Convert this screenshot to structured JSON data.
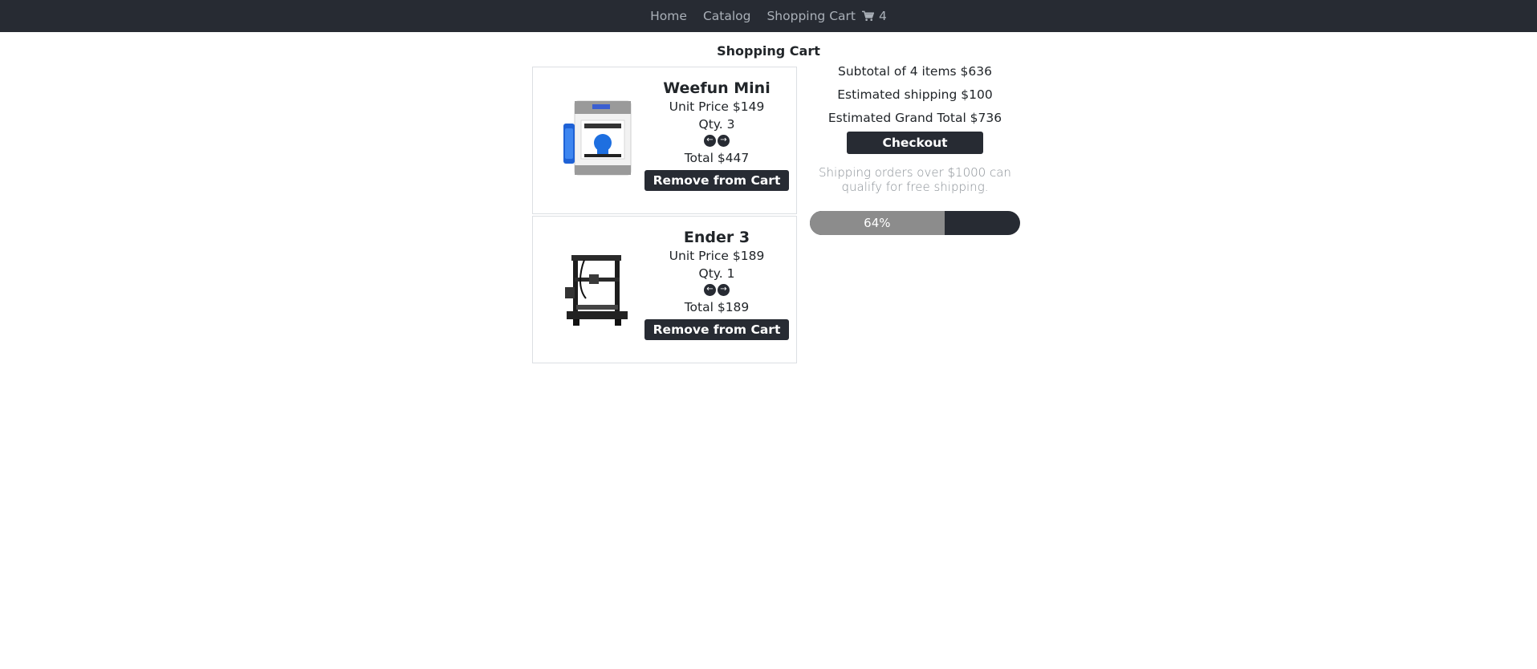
{
  "nav": {
    "home_label": "Home",
    "catalog_label": "Catalog",
    "cart_label": "Shopping Cart",
    "cart_count": "4",
    "cart_icon": "shopping-cart-icon"
  },
  "page": {
    "title": "Shopping Cart"
  },
  "items": [
    {
      "name": "Weefun Mini",
      "unit_price": "Unit Price $149",
      "qty": "Qty. 3",
      "total": "Total $447",
      "remove_label": "Remove from Cart"
    },
    {
      "name": "Ender 3",
      "unit_price": "Unit Price $189",
      "qty": "Qty. 1",
      "total": "Total $189",
      "remove_label": "Remove from Cart"
    }
  ],
  "summary": {
    "subtotal": "Subtotal of 4 items $636",
    "shipping": "Estimated shipping $100",
    "grand_total": "Estimated Grand Total $736",
    "checkout_label": "Checkout",
    "free_shipping_hint": "Shipping orders over $1000 can qualify for free shipping.",
    "progress_label": "64%",
    "progress_value": 64
  },
  "colors": {
    "navbar": "#272b33",
    "progress_fill": "#8c8c8c",
    "accent_dark": "#272b33"
  }
}
